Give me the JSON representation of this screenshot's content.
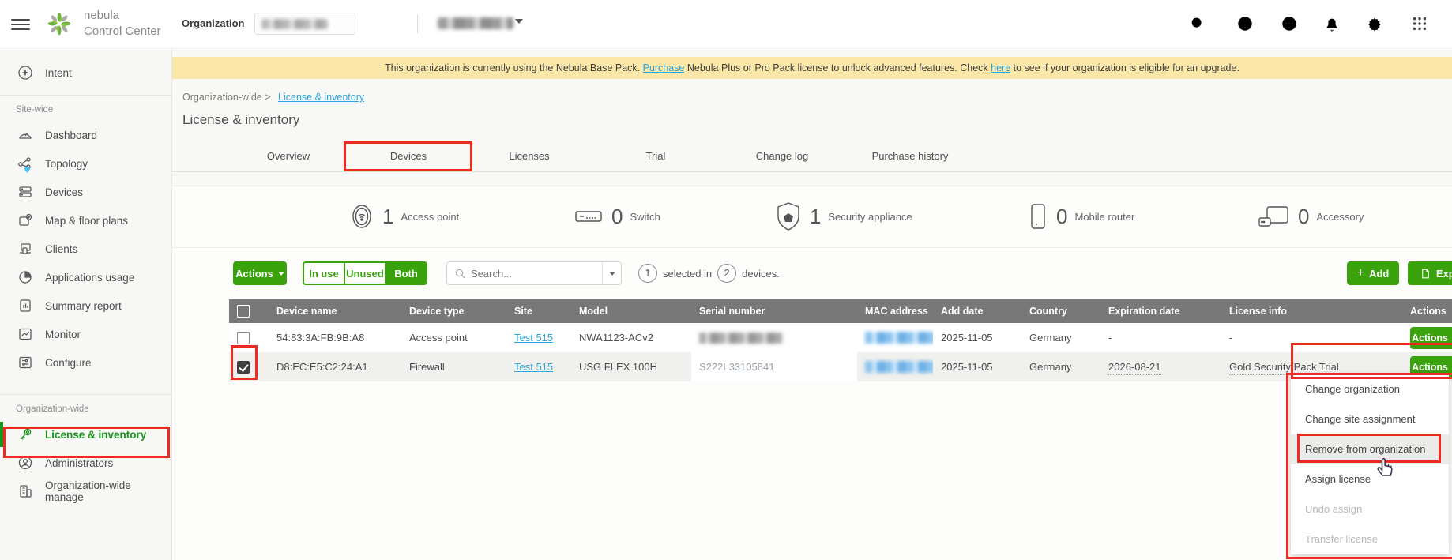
{
  "header": {
    "brand1": "nebula",
    "brand2": "Control Center",
    "org_label": "Organization",
    "icons": [
      "search",
      "help",
      "more",
      "notifications",
      "settings",
      "apps"
    ]
  },
  "banner": {
    "t1": "This organization is currently using the Nebula Base Pack. ",
    "link1": "Purchase",
    "t2": " Nebula Plus or Pro Pack license to unlock advanced features. Check ",
    "link2": "here",
    "t3": " to see if your organization is eligible for an upgrade."
  },
  "breadcrumb": {
    "parent": "Organization-wide >",
    "current": "License & inventory"
  },
  "page_title": "License & inventory",
  "tabs": {
    "labels": [
      "Overview",
      "Devices",
      "Licenses",
      "Trial",
      "Change log",
      "Purchase history"
    ],
    "active": "Devices"
  },
  "sidebar": {
    "intent": "Intent",
    "site_label": "Site-wide",
    "site_items": [
      "Dashboard",
      "Topology",
      "Devices",
      "Map & floor plans",
      "Clients",
      "Applications usage",
      "Summary report",
      "Monitor",
      "Configure"
    ],
    "org_label": "Organization-wide",
    "org_items": [
      "License & inventory",
      "Administrators",
      "Organization-wide manage"
    ],
    "active_item": "License & inventory"
  },
  "summary": {
    "items": [
      {
        "count": "1",
        "label": "Access point"
      },
      {
        "count": "0",
        "label": "Switch"
      },
      {
        "count": "1",
        "label": "Security appliance"
      },
      {
        "count": "0",
        "label": "Mobile router"
      },
      {
        "count": "0",
        "label": "Accessory"
      }
    ]
  },
  "toolbar": {
    "actions_label": "Actions",
    "filter_in_use": "In use",
    "filter_unused": "Unused",
    "filter_both": "Both",
    "filter_active": "Both",
    "search_placeholder": "Search...",
    "selected_count": "1",
    "selected_mid": "selected in",
    "total_count": "2",
    "selected_end": "devices.",
    "add_label": "Add",
    "export_label": "Export"
  },
  "table": {
    "columns": [
      "Device name",
      "Device type",
      "Site",
      "Model",
      "Serial number",
      "MAC address",
      "Add date",
      "Country",
      "Expiration date",
      "License info",
      "Actions"
    ],
    "rows": [
      {
        "checked": false,
        "name": "54:83:3A:FB:9B:A8",
        "type": "Access point",
        "site": "Test 515",
        "model": "NWA1123-ACv2",
        "serial": "",
        "serial_blurred": true,
        "mac": "",
        "mac_blurred": true,
        "add_date": "2025-11-05",
        "country": "Germany",
        "expiration": "-",
        "license": "-",
        "actions_label": "Actions"
      },
      {
        "checked": true,
        "name": "D8:EC:E5:C2:24:A1",
        "type": "Firewall",
        "site": "Test 515",
        "model": "USG FLEX 100H",
        "serial": "S222L33105841",
        "serial_blurred": false,
        "mac": "",
        "mac_blurred": true,
        "add_date": "2025-11-05",
        "country": "Germany",
        "expiration": "2026-08-21",
        "license": "Gold Security Pack Trial",
        "actions_label": "Actions"
      }
    ]
  },
  "menu": {
    "items": [
      {
        "label": "Change organization",
        "state": "normal"
      },
      {
        "label": "Change site assignment",
        "state": "normal"
      },
      {
        "label": "Remove from organization",
        "state": "highlighted"
      },
      {
        "label": "Assign license",
        "state": "normal"
      },
      {
        "label": "Undo assign",
        "state": "disabled"
      },
      {
        "label": "Transfer license",
        "state": "disabled"
      }
    ]
  },
  "colors": {
    "accent_green": "#3aa20c",
    "active_green_text": "#18951d",
    "annotation_red": "#ee2b20",
    "link_blue": "#2aa7e0",
    "banner_bg": "#fbe8a8",
    "table_header_gray": "#787878",
    "row_alt": "#f0f0ee"
  }
}
